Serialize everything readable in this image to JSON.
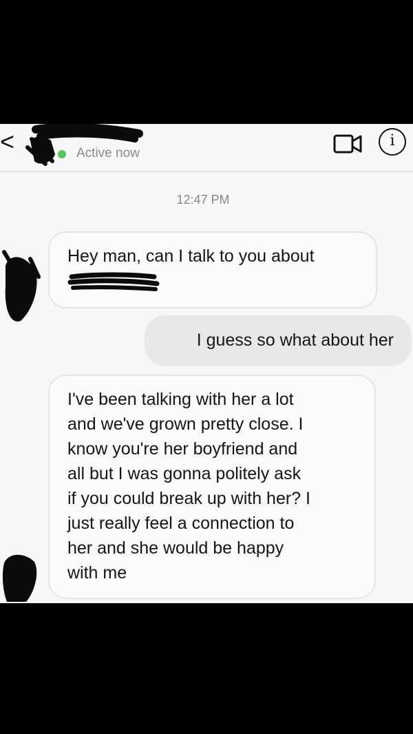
{
  "header": {
    "back_glyph": "<",
    "status": "Active now",
    "info_glyph": "i",
    "icons": {
      "back": "chevron-left-icon",
      "video": "video-call-icon",
      "info": "info-icon"
    },
    "active_color": "#55c65a"
  },
  "conversation": {
    "timestamp": "12:47 PM",
    "messages": [
      {
        "direction": "incoming",
        "lines": [
          "Hey man, can I talk to you about"
        ]
      },
      {
        "direction": "outgoing",
        "lines": [
          "I guess so what about her"
        ]
      },
      {
        "direction": "incoming",
        "lines": [
          "I've been talking with her a lot",
          "and we've grown pretty close. I",
          "know you're her boyfriend and",
          "all but I was gonna politely ask",
          "if you could break up with her? I",
          "just really feel a connection to",
          "her and she would be happy",
          "with me"
        ]
      }
    ]
  }
}
